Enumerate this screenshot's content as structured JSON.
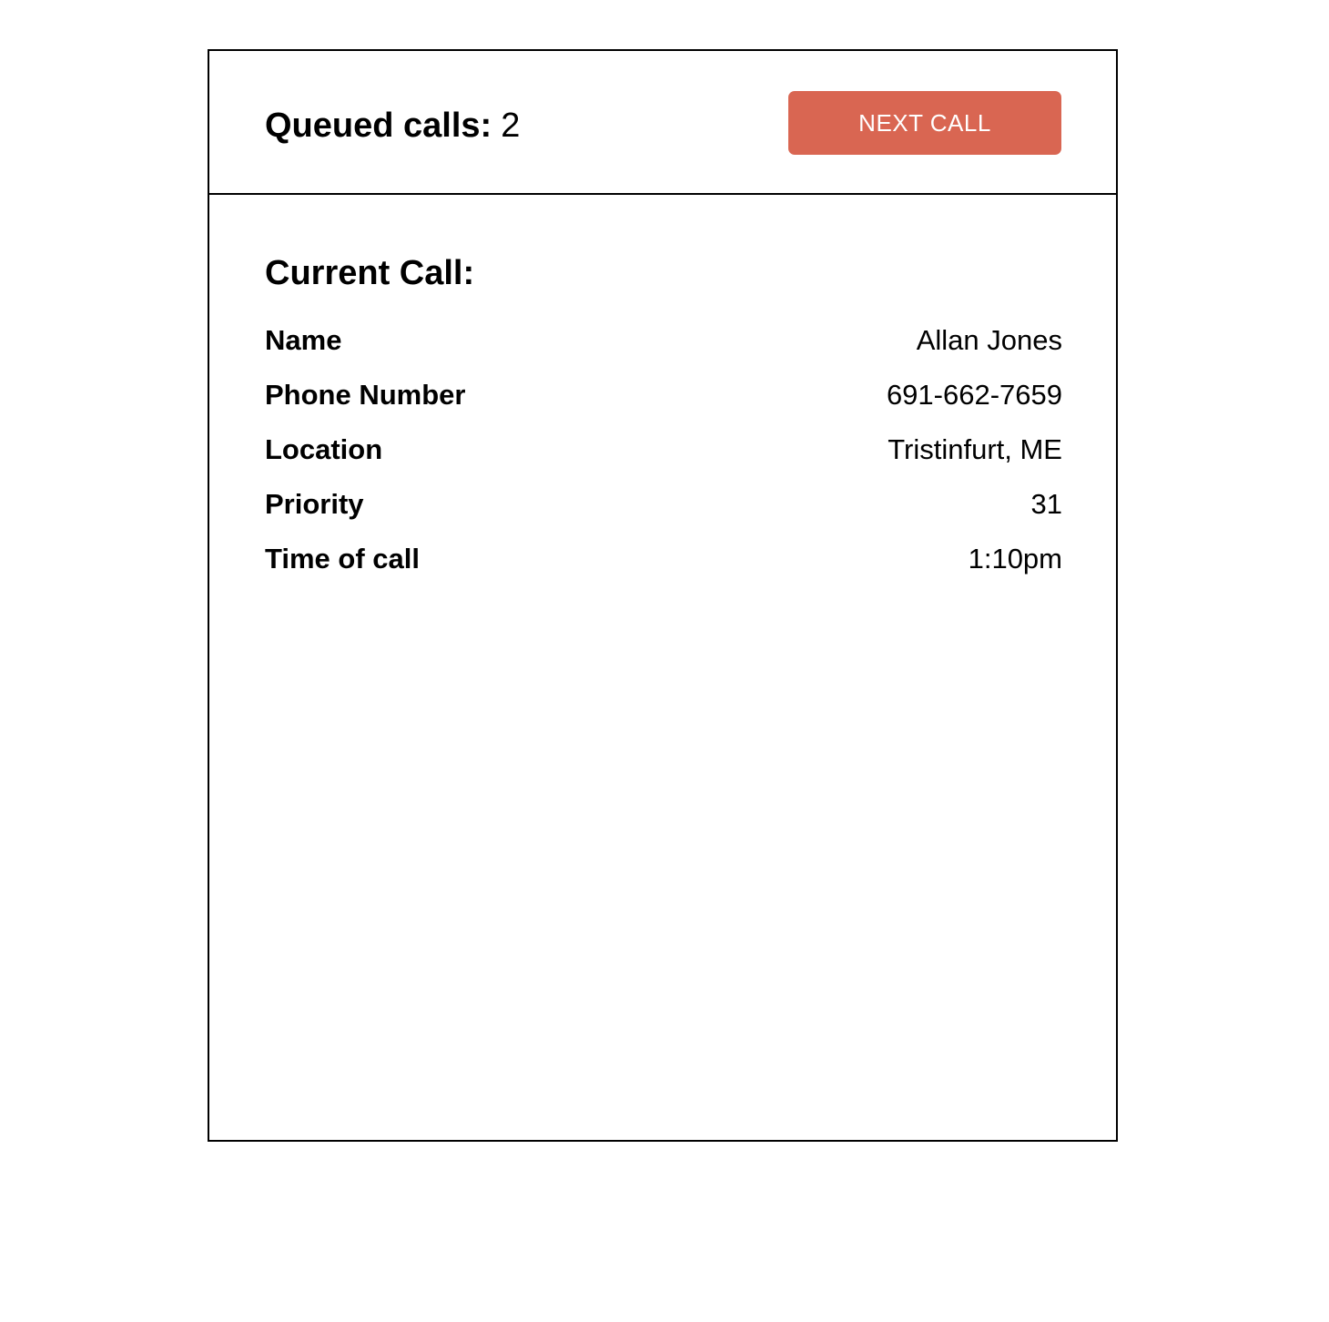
{
  "header": {
    "queue_label": "Queued calls:",
    "queue_count": "2",
    "next_call_label": "NEXT CALL",
    "button_color": "#d96652"
  },
  "current_call": {
    "title": "Current Call:",
    "fields": [
      {
        "label": "Name",
        "value": "Allan Jones"
      },
      {
        "label": "Phone Number",
        "value": "691-662-7659"
      },
      {
        "label": "Location",
        "value": "Tristinfurt, ME"
      },
      {
        "label": "Priority",
        "value": "31"
      },
      {
        "label": "Time of call",
        "value": "1:10pm"
      }
    ]
  }
}
